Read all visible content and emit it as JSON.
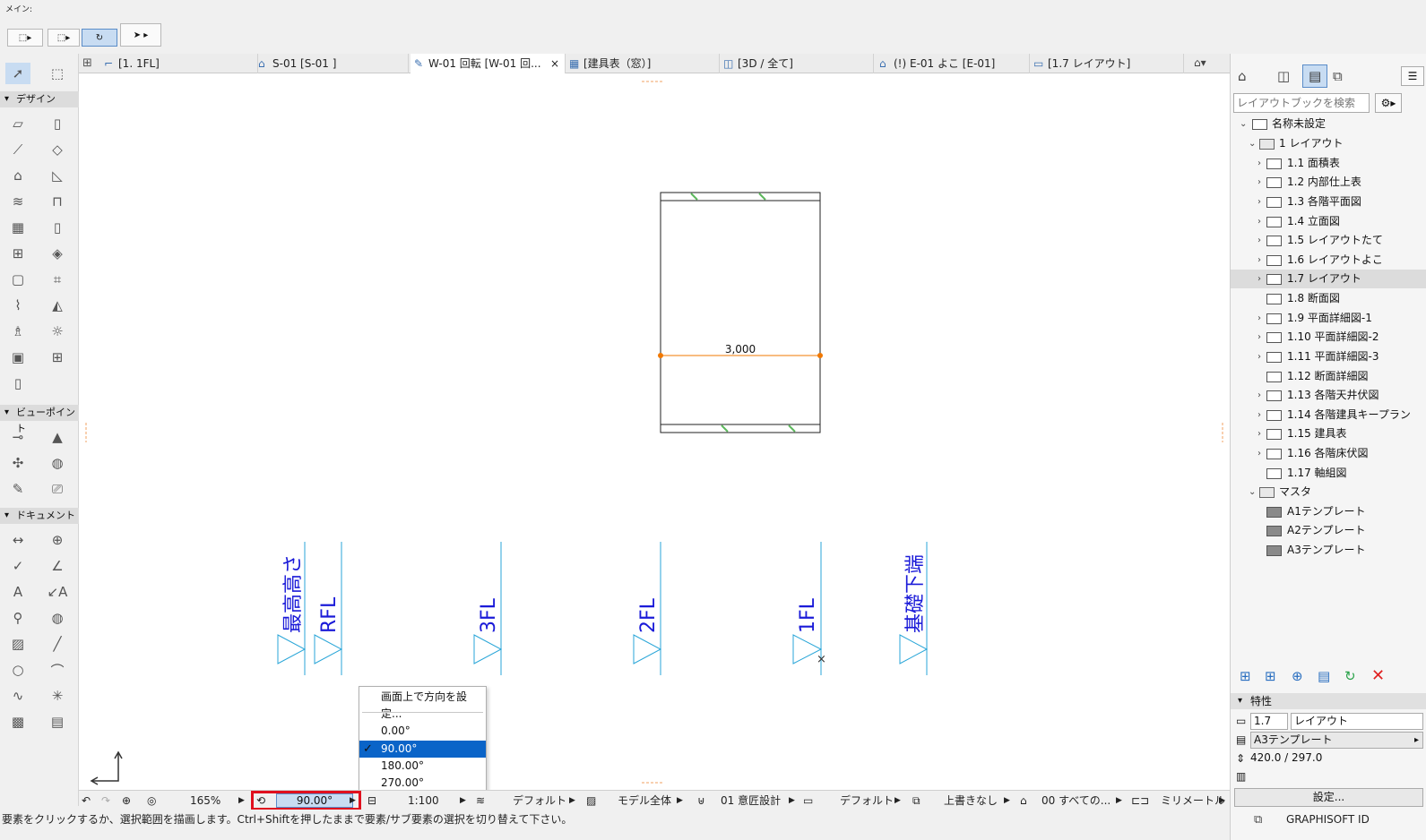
{
  "toolbar": {
    "label": "メイン:"
  },
  "tabs": [
    {
      "label": "[1. 1FL]",
      "icon": "floor-plan-icon"
    },
    {
      "label": "S-01 [S-01 ]",
      "icon": "section-icon"
    },
    {
      "label": "W-01 回転 [W-01 回...",
      "icon": "worksheet-icon"
    },
    {
      "label": "[建具表（窓）]",
      "icon": "schedule-icon"
    },
    {
      "label": "[3D / 全て]",
      "icon": "3d-icon"
    },
    {
      "label": "(!) E-01 よこ [E-01]",
      "icon": "elevation-icon"
    },
    {
      "label": "[1.7 レイアウト]",
      "icon": "layout-icon"
    }
  ],
  "toolbox": {
    "design": "デザイン",
    "viewpoint": "ビューポイント",
    "document": "ドキュメント"
  },
  "drawing": {
    "dimension": "3,000",
    "levels": [
      "最高高さ",
      "RFL",
      "3FL",
      "2FL",
      "1FL",
      "基礎下端"
    ]
  },
  "popup": {
    "set_orientation": "画面上で方向を設定...",
    "options": [
      "0.00°",
      "90.00°",
      "180.00°",
      "270.00°"
    ],
    "selected": "90.00°"
  },
  "statusbar": {
    "zoom": "165%",
    "angle": "90.00°",
    "scale": "1:100",
    "pen_set": "デフォルト",
    "model_view": "モデル全体",
    "layer": "01 意匠設計",
    "dim_standard": "デフォルト",
    "override": "上書きなし",
    "renovation": "00 すべての...",
    "units": "ミリメートル"
  },
  "hint": "要素をクリックするか、選択範囲を描画します。Ctrl+Shiftを押したままで要素/サブ要素の選択を切り替えて下さい。",
  "navigator": {
    "search_placeholder": "レイアウトブックを検索",
    "root": "名称未設定",
    "subset": "1 レイアウト",
    "items": [
      "1.1 面積表",
      "1.2 内部仕上表",
      "1.3 各階平面図",
      "1.4 立面図",
      "1.5 レイアウトたて",
      "1.6 レイアウトよこ",
      "1.7 レイアウト",
      "1.8 断面図",
      "1.9 平面詳細図-1",
      "1.10 平面詳細図-2",
      "1.11 平面詳細図-3",
      "1.12 断面詳細図",
      "1.13 各階天井伏図",
      "1.14 各階建具キープラン",
      "1.15 建具表",
      "1.16 各階床伏図",
      "1.17 軸組図"
    ],
    "masters_folder": "マスタ",
    "masters": [
      "A1テンプレート",
      "A2テンプレート",
      "A3テンプレート"
    ],
    "properties_title": "特性",
    "prop_id": "1.7",
    "prop_name": "レイアウト",
    "prop_master": "A3テンプレート",
    "prop_size": "420.0 / 297.0",
    "settings_button": "設定...",
    "brand": "GRAPHISOFT ID"
  },
  "colors": {
    "accent": "#0a64c8",
    "highlight_box": "#e0101e",
    "level_line": "#2aa6d8",
    "level_text": "#1a1ad8",
    "dim_line": "#f07800"
  }
}
